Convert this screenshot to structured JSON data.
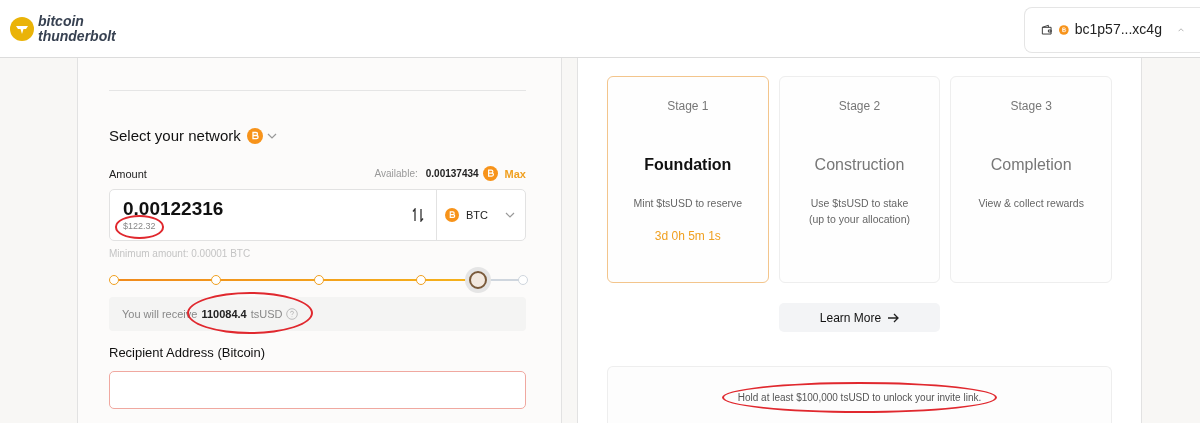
{
  "header": {
    "logo_line_1": "bitcoin",
    "logo_line_2": "thunderbolt",
    "wallet": {
      "address": "bc1p57...xc4g",
      "expanded": true
    }
  },
  "mint": {
    "network_label": "Select your network",
    "amount_label": "Amount",
    "available_label": "Available:",
    "available_value": "0.00137434",
    "max_label": "Max",
    "amount_value": "0.00122316",
    "usd_value": {
      "text": "$122.32",
      "highlighted": true
    },
    "token": "BTC",
    "minimum": "Minimum amount: 0.00001 BTC",
    "slider": {
      "level": 0.89
    },
    "receive": {
      "prefix": "You will receive",
      "amount": "110084.4",
      "unit": "tsUSD",
      "highlighted": true
    },
    "recipient_label": "Recipient Address (Bitcoin)",
    "recipient_invalid": true
  },
  "stages": [
    {
      "stage": "Stage 1",
      "title": "Foundation",
      "description": "Mint $tsUSD to reserve",
      "countdown": "3d 0h 5m 1s",
      "selected": true
    },
    {
      "stage": "Stage 2",
      "title": "Construction",
      "description": "Use $tsUSD to stake\n(up to your allocation)",
      "selected": false
    },
    {
      "stage": "Stage 3",
      "title": "Completion",
      "description": "View & collect rewards",
      "selected": false
    }
  ],
  "learn_more": "Learn More",
  "invite_note": {
    "text": "Hold at least $100,000 tsUSD to unlock your invite link.",
    "highlighted": true
  }
}
